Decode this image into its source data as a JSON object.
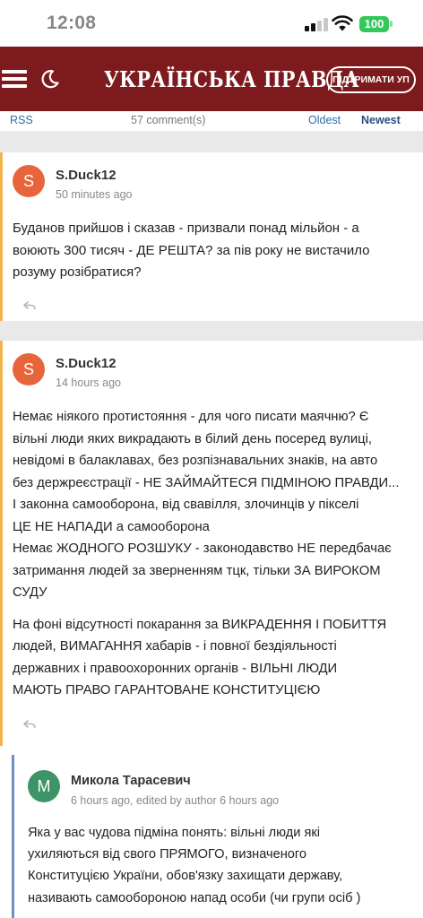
{
  "status_bar": {
    "time": "12:08",
    "battery": "100"
  },
  "header": {
    "logo": "УКРАЇНСЬКА ПРАВДА",
    "support_button": "ПІДТРИМАТИ УП"
  },
  "comments_toolbar": {
    "rss": "RSS",
    "count": "57 comment(s)",
    "oldest": "Oldest",
    "newest": "Newest"
  },
  "comments": [
    {
      "avatar_letter": "S",
      "author": "S.Duck12",
      "time": "50 minutes ago",
      "avatar_color": "#e8643a",
      "paragraphs": [
        [
          "Буданов прийшов і сказав - призвали понад мільйон - а",
          "воюють 300 тисяч - ДЕ РЕШТА? за пів року не вистачило",
          "розуму розібратися?"
        ]
      ]
    },
    {
      "avatar_letter": "S",
      "author": "S.Duck12",
      "time": "14 hours ago",
      "avatar_color": "#e8643a",
      "paragraphs": [
        [
          "Немає ніякого протистояння - для чого писати маячню? Є",
          "вільні люди яких викрадають в білий день посеред вулиці,",
          "невідомі в балаклавах, без розпізнавальних знаків, на авто",
          "без держреєстрації - НЕ ЗАЙМАЙТЕСЯ ПІДМІНОЮ ПРАВДИ...",
          "І законна самооборона, від свавілля, злочинців у пікселі",
          "ЦЕ НЕ НАПАДИ а самооборона",
          "Немає ЖОДНОГО РОЗШУКУ - законодавство НЕ передбачає",
          "затримання людей за зверненням тцк, тільки ЗА ВИРОКОМ",
          "СУДУ"
        ],
        [
          "На фоні відсутності покарання за ВИКРАДЕННЯ І ПОБИТТЯ",
          "людей, ВИМАГАННЯ хабарів - і повної бездіяльності",
          "державних і правоохоронних органів - ВІЛЬНІ ЛЮДИ",
          "МАЮТЬ ПРАВО ГАРАНТОВАНЕ КОНСТИТУЦІЄЮ"
        ]
      ]
    }
  ],
  "reply": {
    "avatar_letter": "M",
    "author": "Микола Тарасевич",
    "time": "6 hours ago, edited by author 6 hours ago",
    "avatar_color": "#3d9467",
    "lines": [
      "Яка у вас чудова підміна понять: вільні люди які",
      "ухиляються від свого ПРЯМОГО, визначеного",
      "Конституцією України, обов'язку захищати державу,",
      "називають самообороною напад особи (чи групи осіб )"
    ]
  },
  "colors": {
    "header": "#7d1a1d",
    "comment_border": "#f2b44c",
    "reply_border": "#6f8fc4",
    "link": "#2e6da4"
  },
  "icons": [
    "menu-icon",
    "moon-icon",
    "reply-icon",
    "wifi-icon",
    "signal-icon",
    "battery-icon"
  ]
}
